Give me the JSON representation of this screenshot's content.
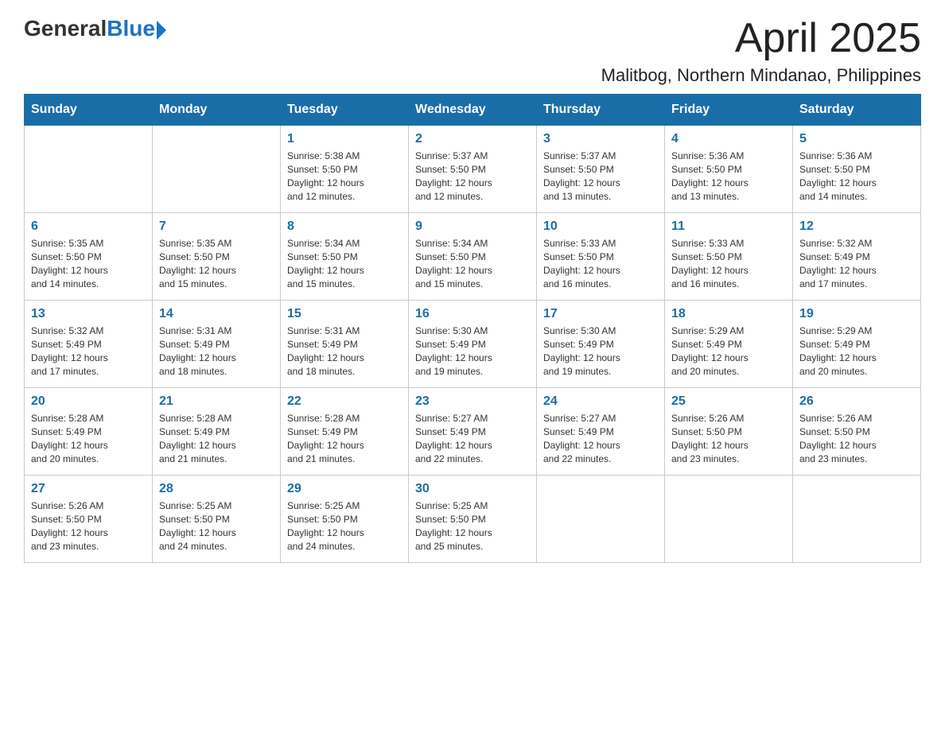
{
  "logo": {
    "general": "General",
    "blue": "Blue",
    "arrow": "▶"
  },
  "header": {
    "month_year": "April 2025",
    "location": "Malitbog, Northern Mindanao, Philippines"
  },
  "columns": [
    "Sunday",
    "Monday",
    "Tuesday",
    "Wednesday",
    "Thursday",
    "Friday",
    "Saturday"
  ],
  "weeks": [
    [
      {
        "day": "",
        "info": ""
      },
      {
        "day": "",
        "info": ""
      },
      {
        "day": "1",
        "info": "Sunrise: 5:38 AM\nSunset: 5:50 PM\nDaylight: 12 hours\nand 12 minutes."
      },
      {
        "day": "2",
        "info": "Sunrise: 5:37 AM\nSunset: 5:50 PM\nDaylight: 12 hours\nand 12 minutes."
      },
      {
        "day": "3",
        "info": "Sunrise: 5:37 AM\nSunset: 5:50 PM\nDaylight: 12 hours\nand 13 minutes."
      },
      {
        "day": "4",
        "info": "Sunrise: 5:36 AM\nSunset: 5:50 PM\nDaylight: 12 hours\nand 13 minutes."
      },
      {
        "day": "5",
        "info": "Sunrise: 5:36 AM\nSunset: 5:50 PM\nDaylight: 12 hours\nand 14 minutes."
      }
    ],
    [
      {
        "day": "6",
        "info": "Sunrise: 5:35 AM\nSunset: 5:50 PM\nDaylight: 12 hours\nand 14 minutes."
      },
      {
        "day": "7",
        "info": "Sunrise: 5:35 AM\nSunset: 5:50 PM\nDaylight: 12 hours\nand 15 minutes."
      },
      {
        "day": "8",
        "info": "Sunrise: 5:34 AM\nSunset: 5:50 PM\nDaylight: 12 hours\nand 15 minutes."
      },
      {
        "day": "9",
        "info": "Sunrise: 5:34 AM\nSunset: 5:50 PM\nDaylight: 12 hours\nand 15 minutes."
      },
      {
        "day": "10",
        "info": "Sunrise: 5:33 AM\nSunset: 5:50 PM\nDaylight: 12 hours\nand 16 minutes."
      },
      {
        "day": "11",
        "info": "Sunrise: 5:33 AM\nSunset: 5:50 PM\nDaylight: 12 hours\nand 16 minutes."
      },
      {
        "day": "12",
        "info": "Sunrise: 5:32 AM\nSunset: 5:49 PM\nDaylight: 12 hours\nand 17 minutes."
      }
    ],
    [
      {
        "day": "13",
        "info": "Sunrise: 5:32 AM\nSunset: 5:49 PM\nDaylight: 12 hours\nand 17 minutes."
      },
      {
        "day": "14",
        "info": "Sunrise: 5:31 AM\nSunset: 5:49 PM\nDaylight: 12 hours\nand 18 minutes."
      },
      {
        "day": "15",
        "info": "Sunrise: 5:31 AM\nSunset: 5:49 PM\nDaylight: 12 hours\nand 18 minutes."
      },
      {
        "day": "16",
        "info": "Sunrise: 5:30 AM\nSunset: 5:49 PM\nDaylight: 12 hours\nand 19 minutes."
      },
      {
        "day": "17",
        "info": "Sunrise: 5:30 AM\nSunset: 5:49 PM\nDaylight: 12 hours\nand 19 minutes."
      },
      {
        "day": "18",
        "info": "Sunrise: 5:29 AM\nSunset: 5:49 PM\nDaylight: 12 hours\nand 20 minutes."
      },
      {
        "day": "19",
        "info": "Sunrise: 5:29 AM\nSunset: 5:49 PM\nDaylight: 12 hours\nand 20 minutes."
      }
    ],
    [
      {
        "day": "20",
        "info": "Sunrise: 5:28 AM\nSunset: 5:49 PM\nDaylight: 12 hours\nand 20 minutes."
      },
      {
        "day": "21",
        "info": "Sunrise: 5:28 AM\nSunset: 5:49 PM\nDaylight: 12 hours\nand 21 minutes."
      },
      {
        "day": "22",
        "info": "Sunrise: 5:28 AM\nSunset: 5:49 PM\nDaylight: 12 hours\nand 21 minutes."
      },
      {
        "day": "23",
        "info": "Sunrise: 5:27 AM\nSunset: 5:49 PM\nDaylight: 12 hours\nand 22 minutes."
      },
      {
        "day": "24",
        "info": "Sunrise: 5:27 AM\nSunset: 5:49 PM\nDaylight: 12 hours\nand 22 minutes."
      },
      {
        "day": "25",
        "info": "Sunrise: 5:26 AM\nSunset: 5:50 PM\nDaylight: 12 hours\nand 23 minutes."
      },
      {
        "day": "26",
        "info": "Sunrise: 5:26 AM\nSunset: 5:50 PM\nDaylight: 12 hours\nand 23 minutes."
      }
    ],
    [
      {
        "day": "27",
        "info": "Sunrise: 5:26 AM\nSunset: 5:50 PM\nDaylight: 12 hours\nand 23 minutes."
      },
      {
        "day": "28",
        "info": "Sunrise: 5:25 AM\nSunset: 5:50 PM\nDaylight: 12 hours\nand 24 minutes."
      },
      {
        "day": "29",
        "info": "Sunrise: 5:25 AM\nSunset: 5:50 PM\nDaylight: 12 hours\nand 24 minutes."
      },
      {
        "day": "30",
        "info": "Sunrise: 5:25 AM\nSunset: 5:50 PM\nDaylight: 12 hours\nand 25 minutes."
      },
      {
        "day": "",
        "info": ""
      },
      {
        "day": "",
        "info": ""
      },
      {
        "day": "",
        "info": ""
      }
    ]
  ]
}
